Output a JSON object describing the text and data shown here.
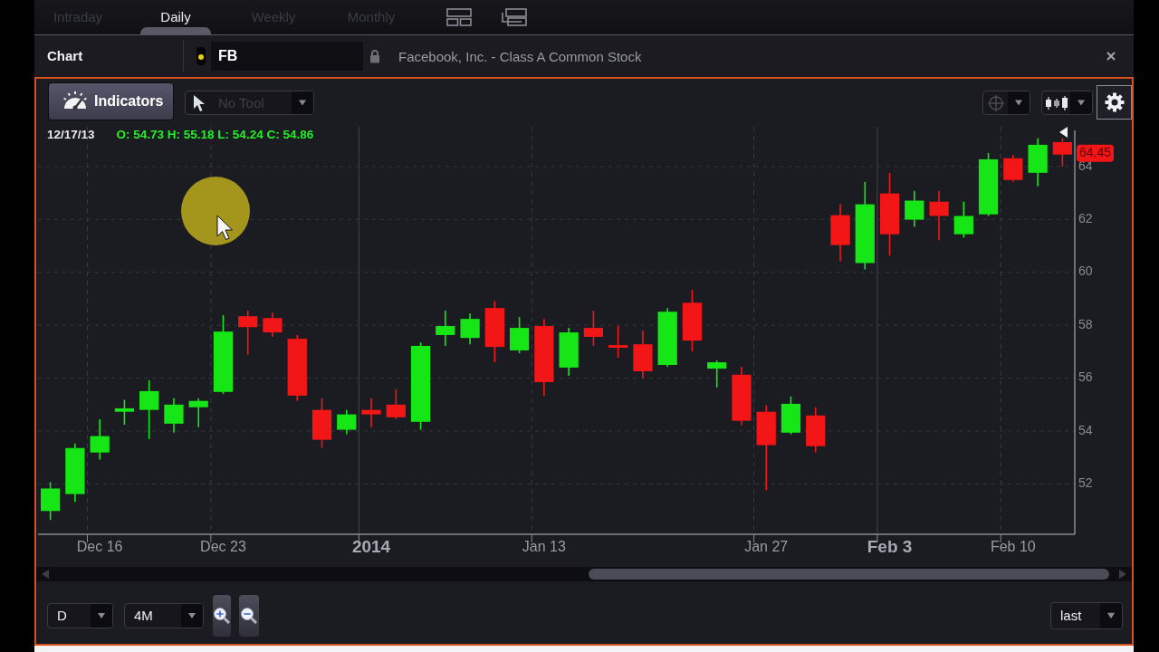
{
  "tabs": [
    {
      "label": "Intraday",
      "selected": false
    },
    {
      "label": "Daily",
      "selected": true
    },
    {
      "label": "Weekly",
      "selected": false
    },
    {
      "label": "Monthly",
      "selected": false
    }
  ],
  "header": {
    "title": "Chart",
    "symbol": "FB",
    "description": "Facebook, Inc. - Class A Common Stock"
  },
  "toolbar": {
    "indicators_button": "Indicators",
    "drawing_tool": {
      "placeholder": "No Tool"
    }
  },
  "chart": {
    "readout": {
      "date": "12/17/13",
      "values": "O: 54.73 H: 55.18 L: 54.24 C: 54.86"
    },
    "last_price": "64.45",
    "chart_data": {
      "type": "candlestick",
      "grid": true,
      "ylim": [
        50.1,
        65.5
      ],
      "yticks": [
        52,
        54,
        56,
        58,
        60,
        62,
        64
      ],
      "categories": [
        null,
        null,
        "Dec 16",
        null,
        null,
        null,
        null,
        "Dec 23",
        null,
        null,
        null,
        null,
        null,
        "2014",
        null,
        null,
        null,
        null,
        null,
        null,
        "Jan 13",
        null,
        null,
        null,
        null,
        null,
        null,
        null,
        null,
        "Jan 27",
        null,
        null,
        null,
        null,
        "Feb 3",
        null,
        null,
        null,
        null,
        "Feb 10",
        null,
        null
      ],
      "series": [
        {
          "ohlc": [
            [
              50.98,
              52.07,
              50.64,
              51.83
            ],
            [
              51.62,
              53.53,
              51.32,
              53.36
            ],
            [
              53.19,
              54.45,
              52.92,
              53.81
            ],
            [
              54.73,
              55.18,
              54.24,
              54.86
            ],
            [
              54.8,
              55.92,
              53.7,
              55.51
            ],
            [
              54.28,
              55.24,
              53.94,
              55.0
            ],
            [
              54.9,
              55.24,
              54.15,
              55.14
            ],
            [
              55.48,
              58.38,
              55.41,
              57.76
            ],
            [
              58.34,
              58.55,
              56.88,
              57.93
            ],
            [
              58.27,
              58.48,
              57.56,
              57.73
            ],
            [
              57.49,
              57.63,
              55.14,
              55.34
            ],
            [
              54.8,
              55.24,
              53.36,
              53.67
            ],
            [
              54.05,
              54.8,
              53.88,
              54.63
            ],
            [
              54.8,
              55.24,
              54.15,
              54.63
            ],
            [
              55.0,
              55.58,
              54.45,
              54.52
            ],
            [
              54.35,
              57.35,
              54.05,
              57.22
            ],
            [
              57.63,
              58.55,
              57.22,
              57.97
            ],
            [
              57.52,
              58.44,
              57.28,
              58.24
            ],
            [
              58.65,
              58.92,
              56.6,
              57.18
            ],
            [
              57.05,
              58.31,
              56.94,
              57.9
            ],
            [
              57.97,
              58.24,
              55.34,
              55.85
            ],
            [
              56.4,
              57.9,
              56.09,
              57.73
            ],
            [
              57.9,
              58.55,
              57.22,
              57.56
            ],
            [
              57.25,
              57.97,
              56.77,
              57.15
            ],
            [
              57.28,
              57.8,
              55.99,
              56.26
            ],
            [
              56.5,
              58.65,
              56.43,
              58.51
            ],
            [
              58.85,
              59.33,
              57.01,
              57.42
            ],
            [
              56.36,
              56.67,
              55.65,
              56.6
            ],
            [
              56.13,
              56.43,
              54.22,
              54.39
            ],
            [
              54.73,
              54.97,
              51.76,
              53.47
            ],
            [
              53.94,
              55.31,
              53.88,
              55.03
            ],
            [
              54.59,
              54.9,
              53.19,
              53.43
            ],
            [
              62.16,
              62.57,
              60.42,
              61.03
            ],
            [
              60.35,
              63.42,
              60.11,
              62.57
            ],
            [
              62.98,
              63.76,
              60.63,
              61.44
            ],
            [
              61.99,
              63.08,
              61.72,
              62.71
            ],
            [
              62.67,
              63.08,
              61.21,
              62.13
            ],
            [
              61.44,
              62.67,
              61.31,
              62.13
            ],
            [
              62.19,
              64.51,
              62.13,
              64.27
            ],
            [
              64.31,
              64.44,
              63.42,
              63.49
            ],
            [
              63.76,
              65.06,
              63.25,
              64.82
            ],
            [
              64.92,
              65.06,
              64.0,
              64.45
            ]
          ]
        }
      ]
    }
  },
  "controls": {
    "period": "D",
    "range": "4M",
    "price_type": "last"
  }
}
